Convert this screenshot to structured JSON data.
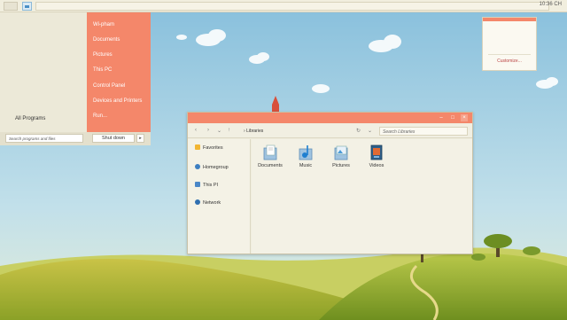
{
  "taskbar": {
    "time": "10:36 CH"
  },
  "start_menu": {
    "items": [
      "Wi-pham",
      "Documents",
      "Pictures",
      "This PC",
      "Control Panel",
      "Devices and Printers",
      "Run..."
    ],
    "all_programs": "All Programs",
    "search_placeholder": "Search programs and files",
    "shutdown": "Shut down",
    "shutdown_arrow": "▸"
  },
  "notification": {
    "customize": "Customize..."
  },
  "explorer": {
    "address": "Libraries",
    "search_placeholder": "Search Libraries",
    "nav": {
      "favorites": "Favorites",
      "homegroup": "Homegroup",
      "this_pc": "This PI",
      "network": "Network"
    },
    "libraries": [
      {
        "label": "Documents"
      },
      {
        "label": "Music"
      },
      {
        "label": "Pictures"
      },
      {
        "label": "Videos"
      }
    ]
  },
  "colors": {
    "accent": "#f4876a",
    "panel": "#ece9d8"
  }
}
